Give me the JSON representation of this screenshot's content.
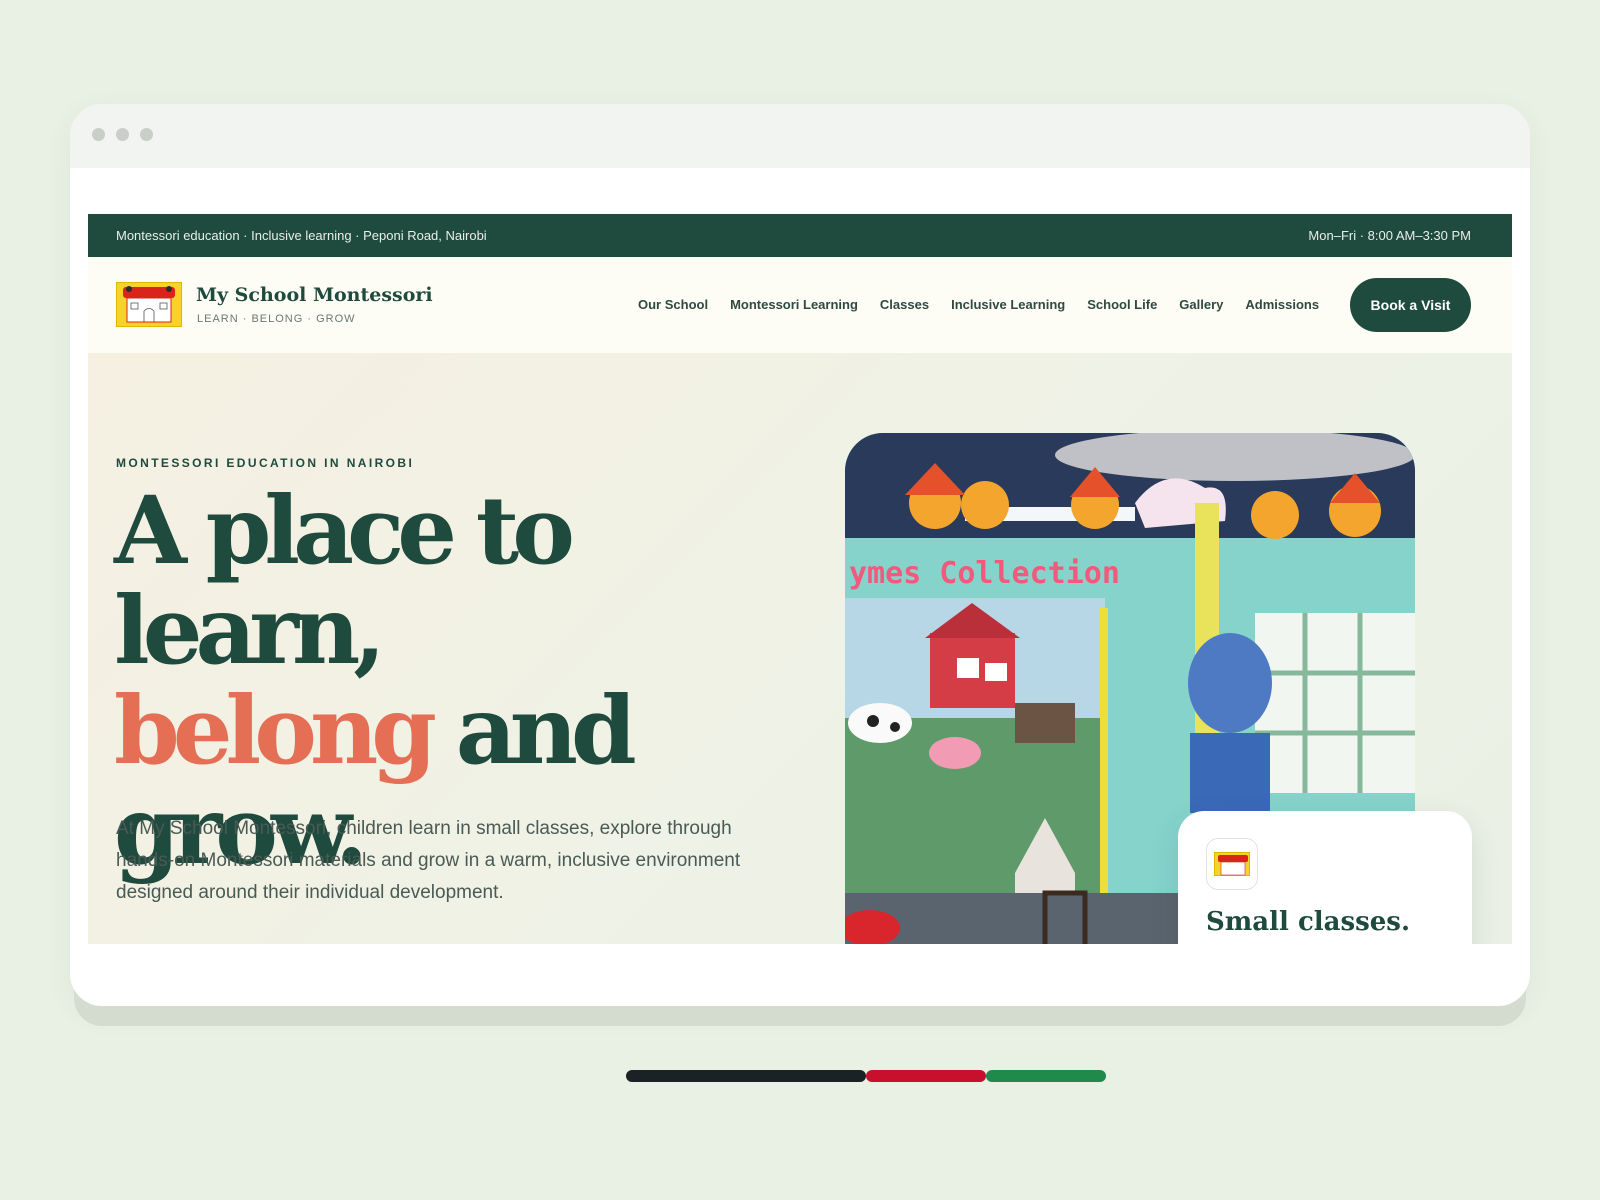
{
  "colors": {
    "brand_green": "#1f4a3e",
    "accent_coral": "#e46f55",
    "page_bg": "#e9f0e4",
    "flag_black": "#1b2226",
    "flag_red": "#c8102e",
    "flag_green": "#1f8a4c"
  },
  "topbar": {
    "left_text": "Montessori education · Inclusive learning · Peponi Road, Nairobi",
    "right_text": "Mon–Fri · 8:00 AM–3:30 PM"
  },
  "brand": {
    "logo_icon": "school-house-logo",
    "name": "My School Montessori",
    "tagline": "LEARN · BELONG · GROW"
  },
  "nav": {
    "items": [
      {
        "label": "Our School"
      },
      {
        "label": "Montessori Learning"
      },
      {
        "label": "Classes"
      },
      {
        "label": "Inclusive Learning"
      },
      {
        "label": "School Life"
      },
      {
        "label": "Gallery"
      },
      {
        "label": "Admissions"
      }
    ],
    "cta_label": "Book a Visit"
  },
  "hero": {
    "eyebrow": "MONTESSORI EDUCATION IN NAIROBI",
    "headline_line1": "A place to learn,",
    "headline_accent": "belong",
    "headline_and": " and",
    "headline_line3": "grow.",
    "lede": "At My School Montessori, children learn in small classes, explore through hands-on Montessori materials and grow in a warm, inclusive environment designed around their individual development.",
    "photo_sign": "ymes Collection",
    "card_title": "Small classes."
  }
}
